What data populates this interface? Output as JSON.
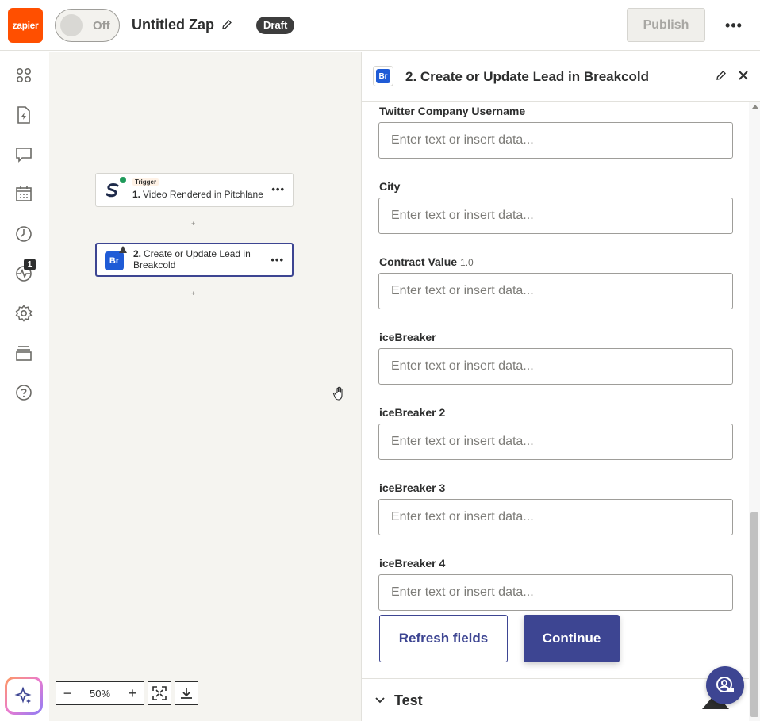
{
  "header": {
    "logo_text": "zapier",
    "toggle_label": "Off",
    "zap_title": "Untitled Zap",
    "status_badge": "Draft",
    "publish_label": "Publish",
    "more_label": "•••"
  },
  "sidebar": {
    "items": [
      {
        "icon": "apps-grid-icon"
      },
      {
        "icon": "zap-file-icon"
      },
      {
        "icon": "chat-icon"
      },
      {
        "icon": "calendar-icon"
      },
      {
        "icon": "history-icon"
      },
      {
        "icon": "activity-icon",
        "badge": "1"
      },
      {
        "icon": "settings-icon"
      },
      {
        "icon": "versions-icon"
      },
      {
        "icon": "help-icon"
      }
    ],
    "ai_button_icon": "sparkle-icon"
  },
  "canvas": {
    "nodes": [
      {
        "tag": "Trigger",
        "number": "1.",
        "title": "Video Rendered in Pitchlane",
        "status": "ok"
      },
      {
        "number": "2.",
        "title": "Create or Update Lead in Breakcold",
        "status": "warning",
        "icon_text": "Br"
      }
    ],
    "more_label": "•••",
    "plus_label": "+",
    "zoom": {
      "level": "50%",
      "minus": "−",
      "plus": "+"
    }
  },
  "panel": {
    "app_icon_text": "Br",
    "title": "2. Create or Update Lead in Breakcold",
    "fields": [
      {
        "label": "Twitter Company Username",
        "placeholder": "Enter text or insert data..."
      },
      {
        "label": "City",
        "placeholder": "Enter text or insert data..."
      },
      {
        "label": "Contract Value",
        "version": "1.0",
        "placeholder": "Enter text or insert data..."
      },
      {
        "label": "iceBreaker",
        "placeholder": "Enter text or insert data..."
      },
      {
        "label": "iceBreaker 2",
        "placeholder": "Enter text or insert data..."
      },
      {
        "label": "iceBreaker 3",
        "placeholder": "Enter text or insert data..."
      },
      {
        "label": "iceBreaker 4",
        "placeholder": "Enter text or insert data..."
      }
    ],
    "refresh_label": "Refresh fields",
    "continue_label": "Continue",
    "test_label": "Test"
  },
  "colors": {
    "brand": "#ff4f00",
    "primary": "#3d4592",
    "breakcold": "#1f5bd6"
  }
}
